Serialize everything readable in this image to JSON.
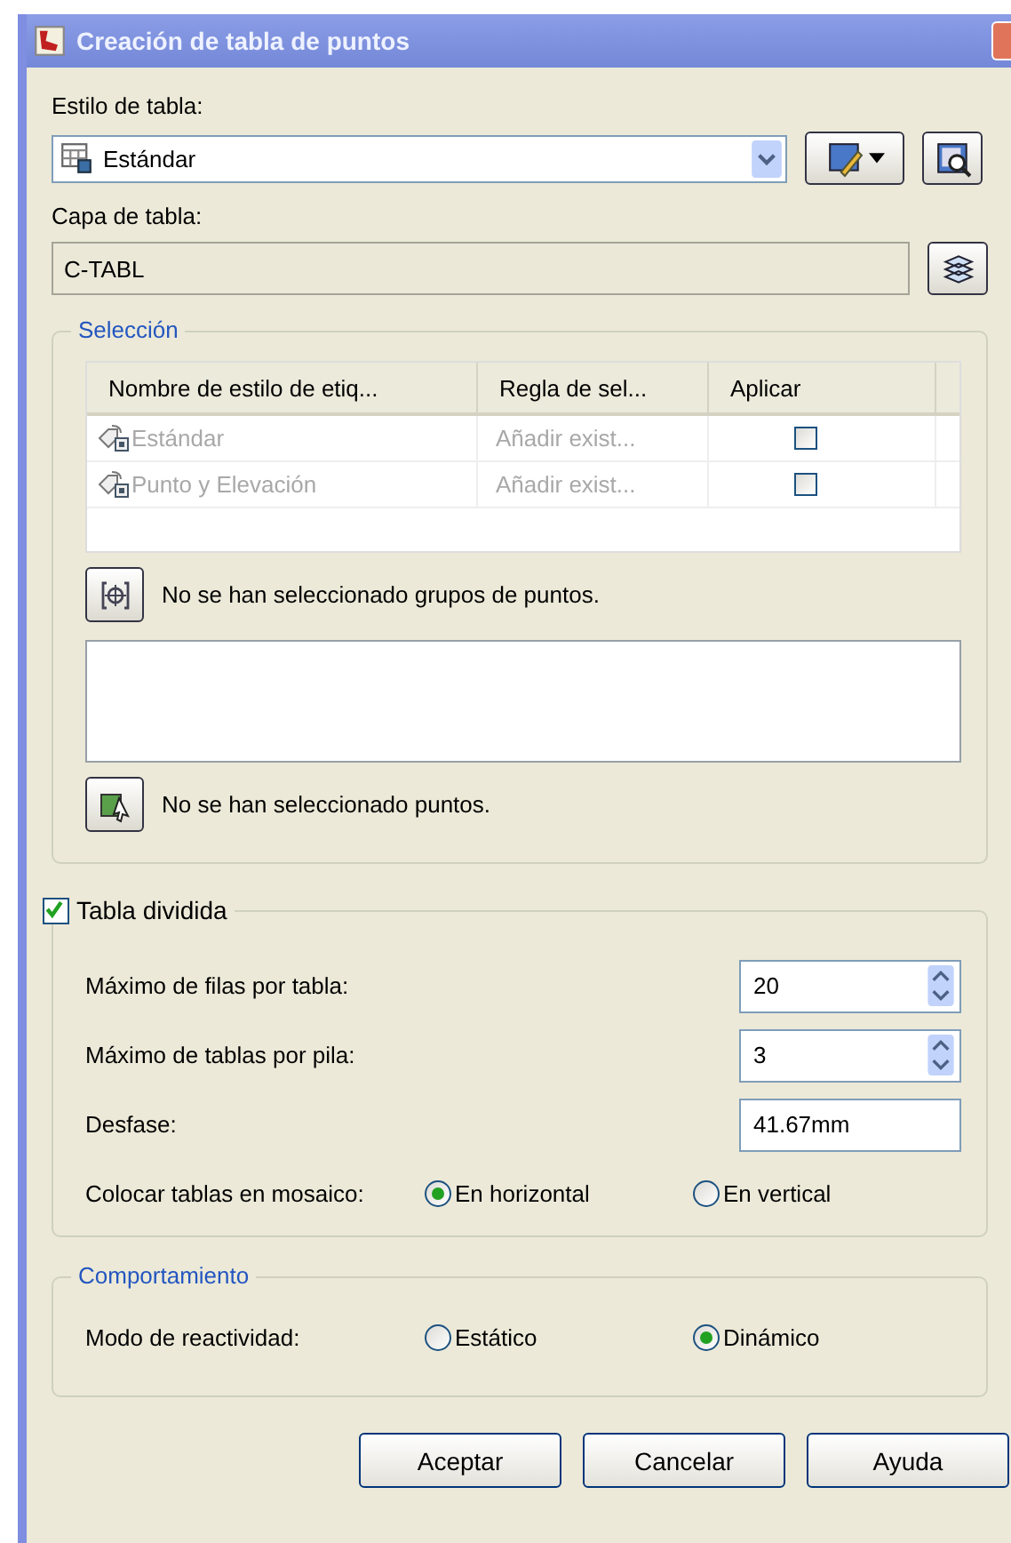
{
  "window": {
    "title": "Creación de tabla de puntos"
  },
  "table_style": {
    "label": "Estilo de tabla:",
    "value": "Estándar"
  },
  "table_layer": {
    "label": "Capa de tabla:",
    "value": "C-TABL"
  },
  "selection": {
    "title": "Selección",
    "columns": [
      "Nombre de estilo de etiq...",
      "Regla de sel...",
      "Aplicar"
    ],
    "rows": [
      {
        "name": "Estándar",
        "rule": "Añadir exist...",
        "checked": false,
        "disabled": true
      },
      {
        "name": "Punto y Elevación",
        "rule": "Añadir exist...",
        "checked": false,
        "disabled": true
      }
    ],
    "groups_message": "No se han seleccionado grupos de puntos.",
    "points_message": "No se han seleccionado puntos."
  },
  "split_table": {
    "label": "Tabla dividida",
    "checked": true,
    "fields": [
      {
        "label": "Máximo de filas por tabla:",
        "value": "20",
        "kind": "spinner"
      },
      {
        "label": "Máximo de tablas por pila:",
        "value": "3",
        "kind": "spinner"
      },
      {
        "label": "Desfase:",
        "value": "41.67mm",
        "kind": "text"
      }
    ],
    "tile": {
      "label": "Colocar tablas en mosaico:",
      "options": [
        {
          "label": "En horizontal",
          "selected": true
        },
        {
          "label": "En vertical",
          "selected": false
        }
      ]
    }
  },
  "behavior": {
    "title": "Comportamiento",
    "label": "Modo de reactividad:",
    "options": [
      {
        "label": "Estático",
        "selected": false
      },
      {
        "label": "Dinámico",
        "selected": true
      }
    ]
  },
  "buttons": [
    "Aceptar",
    "Cancelar",
    "Ayuda"
  ]
}
